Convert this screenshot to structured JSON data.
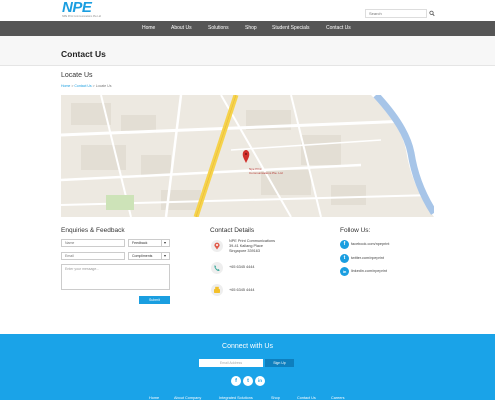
{
  "header": {
    "logo_text": "NPE",
    "logo_subtext": "NPE Print Communications Pte Ltd",
    "search_placeholder": "Search"
  },
  "nav": {
    "items": [
      {
        "label": "Home"
      },
      {
        "label": "About Us"
      },
      {
        "label": "Solutions"
      },
      {
        "label": "Shop"
      },
      {
        "label": "Student Specials"
      },
      {
        "label": "Contact Us"
      }
    ]
  },
  "page": {
    "title": "Contact Us",
    "section_title": "Locate Us",
    "breadcrumb": {
      "home": "Home",
      "parent": "Contact Us",
      "current": "Locate Us",
      "separator": ">"
    }
  },
  "map": {
    "marker_label_line1": "Npe Print",
    "marker_label_line2": "Communications Pte. Ltd",
    "marker_color": "#d0302b",
    "road_color": "#f6d34b",
    "water_color": "#a7c5e8"
  },
  "enquiries": {
    "title": "Enquiries & Feedback",
    "name_placeholder": "Name",
    "email_placeholder": "Email",
    "type_value": "Feedback",
    "type2_value": "Compliments",
    "message_placeholder": "Enter your message...",
    "submit_label": "Submit"
  },
  "contact_details": {
    "title": "Contact Details",
    "address_line1": "NPE Print Communications",
    "address_line2": "39-41 Kallang Place",
    "address_line3": "Singapore 339163",
    "phone": "+65 6345 4444",
    "fax": "+65 6345 4444",
    "icons": [
      "map-pin-icon",
      "phone-icon",
      "fax-icon"
    ]
  },
  "follow": {
    "title": "Follow Us:",
    "links": [
      {
        "icon": "f",
        "label": "facebook.com/npeprint"
      },
      {
        "icon": "t",
        "label": "twitter.com/npeprint"
      },
      {
        "icon": "in",
        "label": "linkedin.com/npeprint"
      }
    ]
  },
  "footer": {
    "title": "Connect with Us",
    "email_placeholder": "Email Address",
    "signup_label": "Sign Up",
    "social": [
      {
        "icon": "f"
      },
      {
        "icon": "t"
      },
      {
        "icon": "in"
      }
    ],
    "nav": [
      {
        "label": "Home"
      },
      {
        "label": "About Company"
      },
      {
        "label": "Integrated Solutions"
      },
      {
        "label": "Shop"
      },
      {
        "label": "Contact Us"
      },
      {
        "label": "Careers"
      }
    ],
    "background_color": "#1aa3e8"
  }
}
